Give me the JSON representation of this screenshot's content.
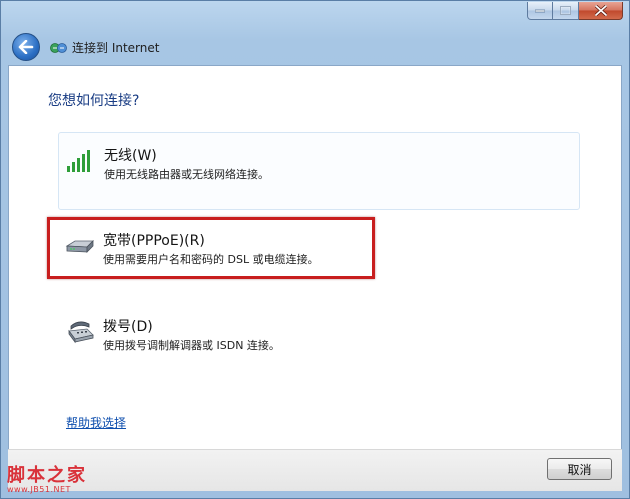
{
  "nav": {
    "title": "连接到 Internet"
  },
  "heading": "您想如何连接?",
  "options": [
    {
      "title": "无线(W)",
      "description": "使用无线路由器或无线网络连接。",
      "icon": "wireless-signal-icon"
    },
    {
      "title": "宽带(PPPoE)(R)",
      "description": "使用需要用户名和密码的 DSL 或电缆连接。",
      "icon": "broadband-modem-icon"
    },
    {
      "title": "拨号(D)",
      "description": "使用拨号调制解调器或 ISDN 连接。",
      "icon": "dialup-phone-icon"
    }
  ],
  "help_link": "帮助我选择",
  "cancel_label": "取消",
  "watermark": {
    "main": "脚本之家",
    "sub": "www.JB51.NET"
  },
  "colors": {
    "highlight": "#c81e1e",
    "heading": "#1a3d84",
    "link": "#0f4fae",
    "watermark": "#d9323a"
  }
}
